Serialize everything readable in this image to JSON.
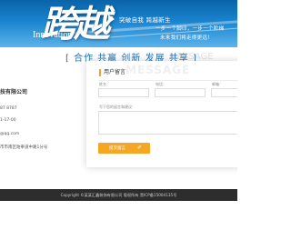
{
  "banner": {
    "calligraphy": "跨越",
    "brand_word": "Innovation",
    "slogan_main": "突破自我  跨越新生",
    "slogan_line1": "一步一个脚印，一步一个阶梯",
    "slogan_line2": "未来我们将走得更远！"
  },
  "tagline": "[ 合作 共赢 创新 发展 共享 ]",
  "tagline_watermark": "MESSAGE",
  "company": {
    "name": "技有限公司",
    "tel": "87 8787",
    "mobile": "1-17-00",
    "email": "@qq.com",
    "address": "市市南区跆拳道中路1分号"
  },
  "form": {
    "title": "用户留言",
    "name_label": "姓名：",
    "phone_label": "电话：",
    "email_label": "邮箱：",
    "message_label": "写下您的留言和建议：",
    "submit_label": "提交留言"
  },
  "footer": {
    "copyright": "Copyright ©某某汇鑫装饰有限公司 版权所有 黑ICP备15004135号"
  },
  "colors": {
    "banner_blue": "#1a84cf",
    "tagline_blue": "#1f6fb3",
    "accent_orange": "#f5a623",
    "footer_bg": "#2d2d2d"
  }
}
